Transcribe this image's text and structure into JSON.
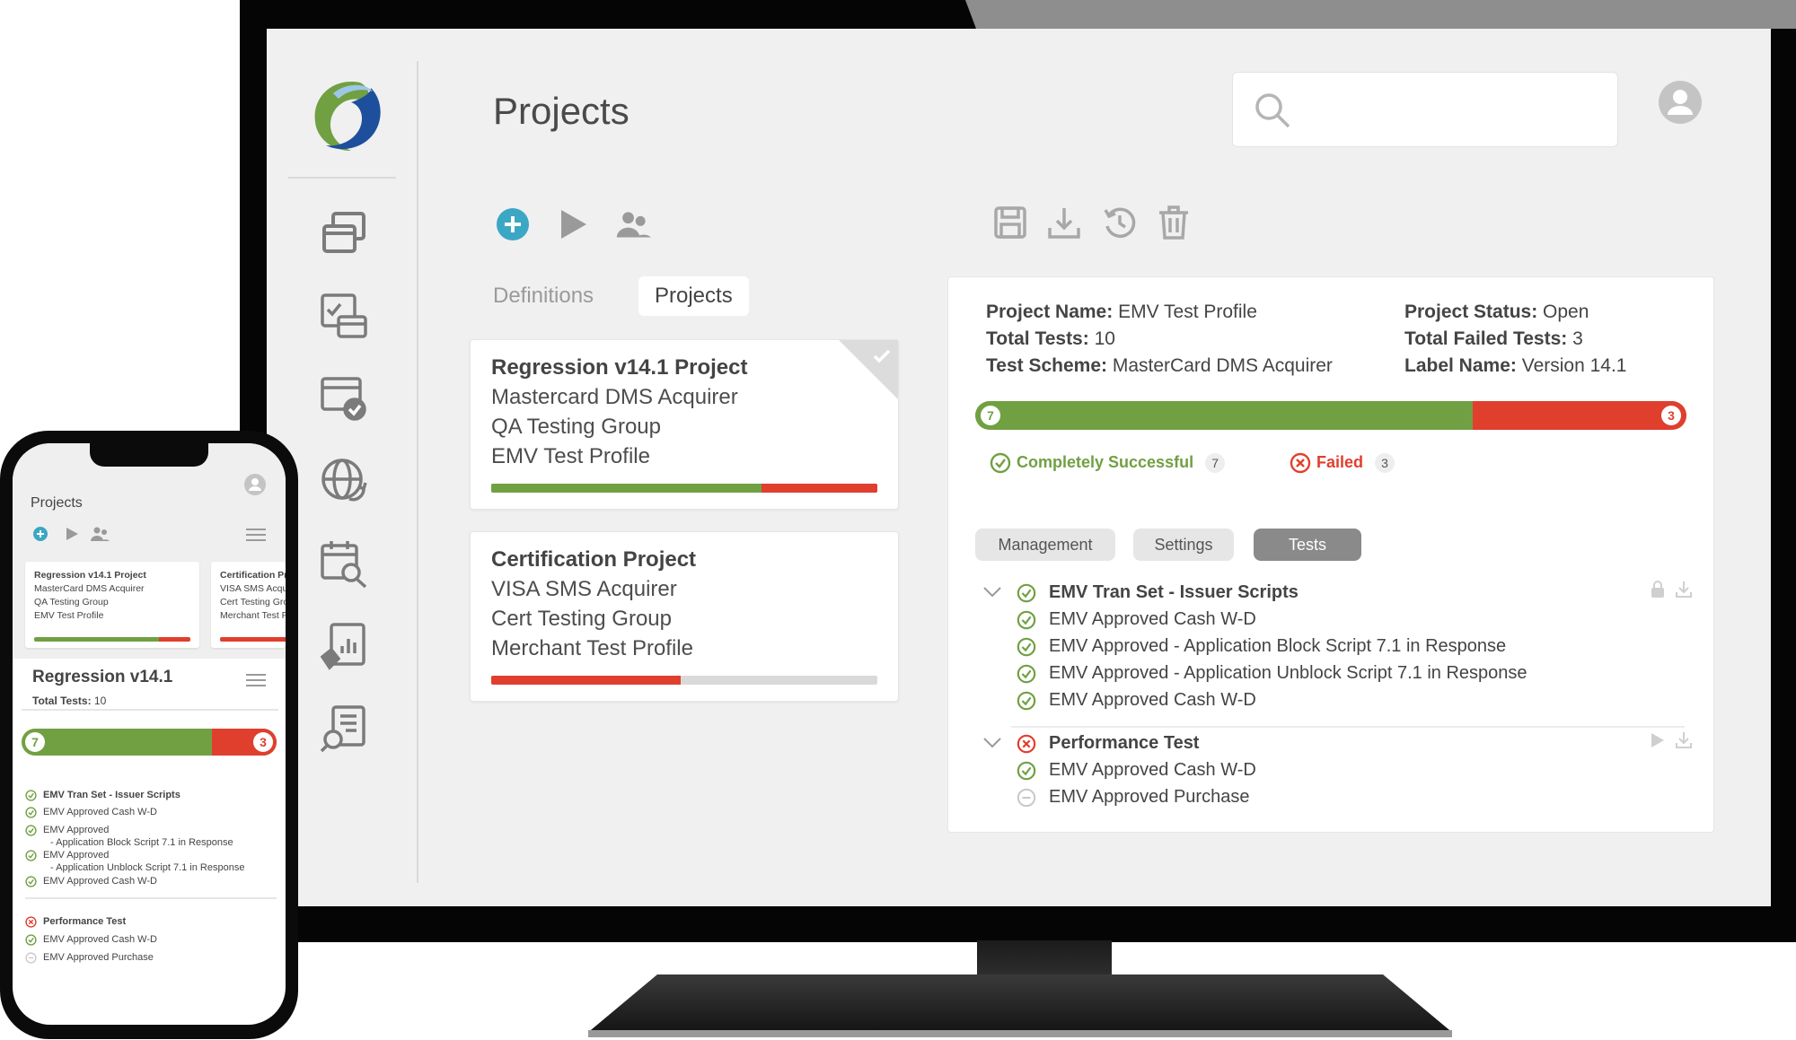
{
  "app": {
    "page_title": "Projects",
    "search_placeholder": "",
    "colors": {
      "success": "#71a043",
      "fail": "#e03f2e",
      "accent": "#3ba7c4",
      "icon": "#7b7b7b"
    }
  },
  "sidebar": {
    "items": [
      {
        "icon": "windows-icon"
      },
      {
        "icon": "checklist-card-icon"
      },
      {
        "icon": "card-check-icon"
      },
      {
        "icon": "globe-refresh-icon"
      },
      {
        "icon": "calendar-search-icon"
      },
      {
        "icon": "report-chart-icon"
      },
      {
        "icon": "document-search-icon"
      }
    ]
  },
  "toolbar": {
    "left": [
      "add-icon",
      "play-icon",
      "users-icon"
    ],
    "right": [
      "save-icon",
      "download-icon",
      "history-icon",
      "trash-icon"
    ]
  },
  "tabs": [
    {
      "label": "Definitions",
      "active": false
    },
    {
      "label": "Projects",
      "active": true
    }
  ],
  "projects": [
    {
      "title": "Regression v14.1 Project",
      "lines": [
        "Mastercard DMS Acquirer",
        "QA Testing Group",
        "EMV Test Profile"
      ],
      "progress": {
        "success": 0.7,
        "fail": 0.3
      },
      "selected": true
    },
    {
      "title": "Certification Project",
      "lines": [
        "VISA SMS Acquirer",
        "Cert Testing Group",
        "Merchant Test Profile"
      ],
      "progress": {
        "success": 0,
        "fail": 0.49
      },
      "selected": false
    }
  ],
  "detail": {
    "labels": {
      "project_name": "Project Name:",
      "total_tests": "Total Tests:",
      "test_scheme": "Test Scheme:",
      "project_status": "Project Status:",
      "total_failed": "Total Failed Tests:",
      "label_name": "Label Name:"
    },
    "values": {
      "project_name": "EMV Test Profile",
      "total_tests": "10",
      "test_scheme": "MasterCard DMS Acquirer",
      "project_status": "Open",
      "total_failed": "3",
      "label_name": "Version 14.1"
    },
    "bar": {
      "success_count": "7",
      "fail_count": "3",
      "success_fraction": 0.7
    },
    "legend": {
      "success_label": "Completely Successful",
      "success_count": "7",
      "fail_label": "Failed",
      "fail_count": "3"
    },
    "subtabs": [
      {
        "label": "Management",
        "active": false
      },
      {
        "label": "Settings",
        "active": false
      },
      {
        "label": "Tests",
        "active": true
      }
    ],
    "groups": [
      {
        "title": "EMV Tran Set - Issuer Scripts",
        "status": "success",
        "items": [
          {
            "label": "EMV Approved Cash W-D",
            "status": "success"
          },
          {
            "label": "EMV Approved - Application Block Script 7.1 in Response",
            "status": "success"
          },
          {
            "label": "EMV Approved - Application Unblock Script 7.1 in Response",
            "status": "success"
          },
          {
            "label": "EMV Approved Cash W-D",
            "status": "success"
          }
        ]
      },
      {
        "title": "Performance Test",
        "status": "fail",
        "items": [
          {
            "label": "EMV Approved Cash W-D",
            "status": "success"
          },
          {
            "label": "EMV Approved Purchase",
            "status": "pending"
          }
        ]
      }
    ]
  },
  "phone": {
    "title": "Projects",
    "cards": [
      {
        "lines": [
          "Regression v14.1 Project",
          "MasterCard DMS Acquirer",
          "QA Testing Group",
          "EMV Test Profile"
        ]
      },
      {
        "lines": [
          "Certification Project",
          "VISA SMS Acquirer",
          "Cert Testing Group",
          "Merchant Test Profile"
        ]
      }
    ],
    "section_title": "Regression v14.1",
    "total_label": "Total Tests:",
    "total_value": "10",
    "bar": {
      "success_count": "7",
      "fail_count": "3"
    },
    "groups": [
      {
        "title": "EMV Tran Set - Issuer Scripts",
        "items": [
          "EMV Approved Cash W-D",
          "EMV Approved",
          "- Application Block Script 7.1 in Response",
          "EMV Approved",
          "- Application Unblock Script 7.1 in Response",
          "EMV Approved Cash W-D"
        ]
      },
      {
        "title": "Performance Test",
        "items": [
          "EMV Approved Cash W-D",
          "EMV Approved Purchase"
        ]
      }
    ]
  }
}
